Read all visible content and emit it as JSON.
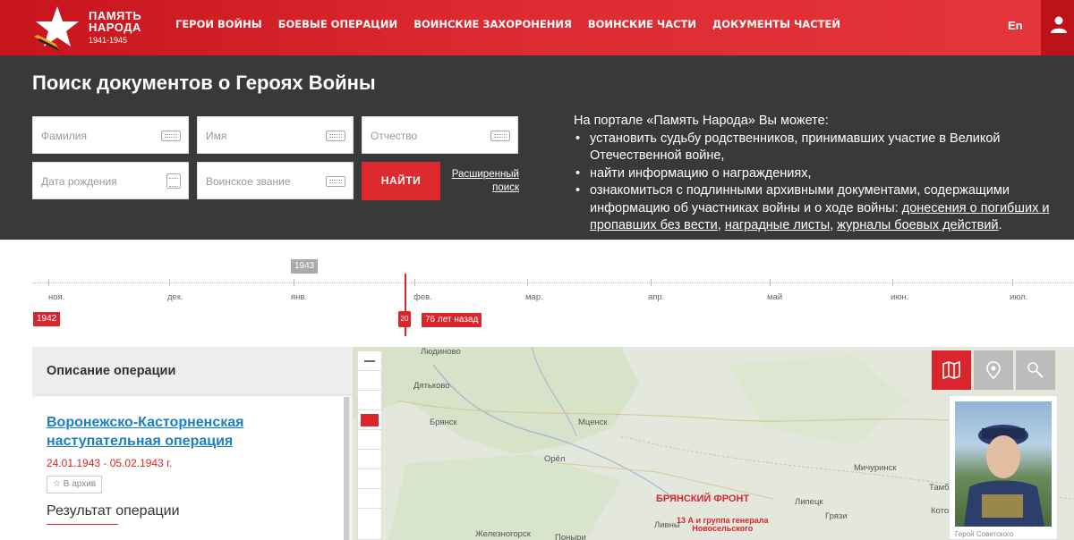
{
  "header": {
    "logo": {
      "line1": "ПАМЯТЬ",
      "line2": "НАРОДА",
      "years": "1941-1945"
    },
    "nav": [
      "ГЕРОИ ВОЙНЫ",
      "БОЕВЫЕ ОПЕРАЦИИ",
      "ВОИНСКИЕ ЗАХОРОНЕНИЯ",
      "ВОИНСКИЕ ЧАСТИ",
      "ДОКУМЕНТЫ ЧАСТЕЙ"
    ],
    "lang": "En",
    "user_icon": "user-icon"
  },
  "search": {
    "title": "Поиск документов о Героях Войны",
    "surname_placeholder": "Фамилия",
    "name_placeholder": "Имя",
    "patronymic_placeholder": "Отчество",
    "birthdate_placeholder": "Дата рождения",
    "rank_placeholder": "Воинское звание",
    "find_label": "НАЙТИ",
    "advanced_line1": "Расширенный",
    "advanced_line2": "поиск"
  },
  "info": {
    "intro": "На портале «Память Народа» Вы можете:",
    "item1": "установить судьбу родственников, принимавших участие в Великой Отечественной войне,",
    "item2": "найти информацию о награждениях,",
    "item3_text": "ознакомиться с подлинными архивными документами, содержащими информацию об участниках войны и о ходе войны: ",
    "link1": "донесения о погибших и пропавших без вести",
    "sep1": ", ",
    "link2": "наградные листы",
    "sep2": ", ",
    "link3": "журналы боевых действий",
    "end": "."
  },
  "timeline": {
    "months": [
      "ноя.",
      "дек.",
      "янв.",
      "фев.",
      "мар.",
      "апр.",
      "май",
      "июн.",
      "июл."
    ],
    "year_badge": "1943",
    "start_year": "1942",
    "cursor_day": "20",
    "ago": "76 лет назад"
  },
  "operation": {
    "header": "Описание операции",
    "name": "Воронежско-Касторненская наступательная операция",
    "dates": "24.01.1943 - 05.02.1943 г.",
    "archive": "В архив",
    "result": "Результат операции"
  },
  "map": {
    "cities": [
      "Людиново",
      "Дятьково",
      "Брянск",
      "Мценск",
      "Орёл",
      "Мичуринск",
      "Липецк",
      "Тамб",
      "Ливны",
      "Грязи",
      "Котовск",
      "Железногорск",
      "Поныри"
    ],
    "front": "БРЯНСКИЙ ФРОНТ",
    "army_line1": "13 А и группа генерала",
    "army_line2": "Новосельского",
    "portrait_caption": "Герой Советского"
  },
  "colors": {
    "brand_red": "#d9252b",
    "panel_dark": "#38393b",
    "link_blue": "#1b7fc4"
  }
}
